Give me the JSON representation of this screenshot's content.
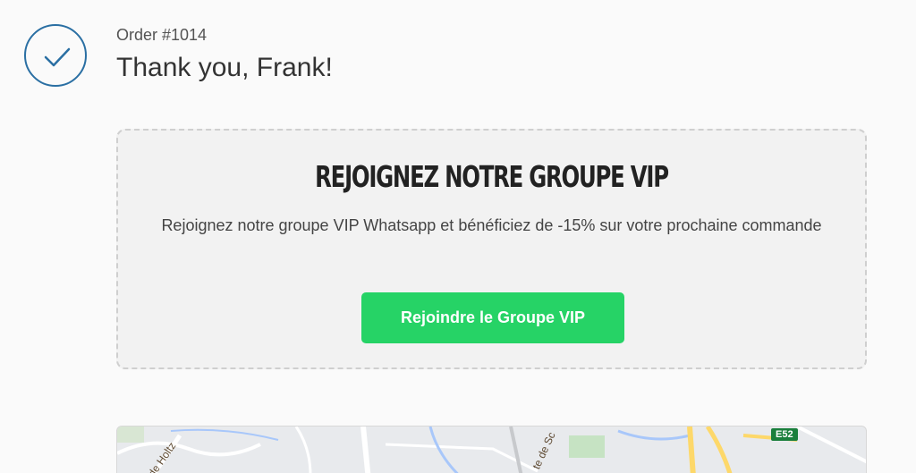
{
  "icons": {
    "check": "check-circle-icon"
  },
  "colors": {
    "accent": "#2a6fa3",
    "vip_button": "#26d366"
  },
  "order": {
    "number": "Order #1014",
    "thanks": "Thank you, Frank!"
  },
  "vip": {
    "title": "REJOIGNEZ NOTRE GROUPE VIP",
    "text": "Rejoignez notre groupe VIP Whatsapp et bénéficiez de -15% sur votre prochaine commande",
    "button_label": "Rejoindre le Groupe VIP"
  },
  "map": {
    "street_label_1": "de Holtz",
    "street_label_2": "te de Sc",
    "road_badge": "E52"
  }
}
